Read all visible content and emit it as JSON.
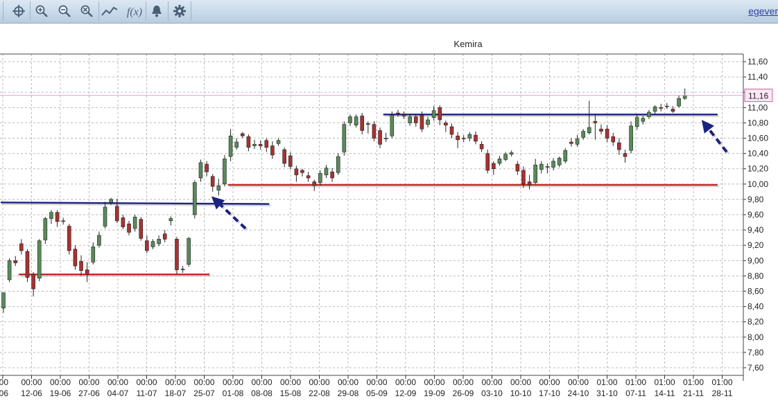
{
  "toolbar": {
    "buttons": [
      {
        "name": "crosshair-icon"
      },
      {
        "name": "zoom-in-icon"
      },
      {
        "name": "zoom-out-icon"
      },
      {
        "name": "zoom-reset-icon"
      },
      {
        "name": "line-tool-icon"
      },
      {
        "name": "function-icon"
      },
      {
        "name": "alert-bell-icon"
      },
      {
        "name": "settings-gear-icon"
      }
    ],
    "function_label": "f(x)",
    "link_text": "egever"
  },
  "chart_data": {
    "type": "candlestick",
    "title": "Kemira",
    "ylim": [
      7.5,
      11.7
    ],
    "yticks": [
      "7,60",
      "7,80",
      "8,00",
      "8,20",
      "8,40",
      "8,60",
      "8,80",
      "9,00",
      "9,20",
      "9,40",
      "9,60",
      "9,80",
      "10,00",
      "10,20",
      "10,40",
      "10,60",
      "10,80",
      "11,00",
      "11,20",
      "11,40",
      "11,60"
    ],
    "last_price_label": "11,16",
    "last_price": 11.16,
    "x_ticks": [
      {
        "top": "00",
        "bottom": "06"
      },
      {
        "top": "00:00",
        "bottom": "12-06"
      },
      {
        "top": "00:00",
        "bottom": "19-06"
      },
      {
        "top": "00:00",
        "bottom": "27-06"
      },
      {
        "top": "00:00",
        "bottom": "04-07"
      },
      {
        "top": "00:00",
        "bottom": "11-07"
      },
      {
        "top": "00:00",
        "bottom": "18-07"
      },
      {
        "top": "00:00",
        "bottom": "25-07"
      },
      {
        "top": "00:00",
        "bottom": "01-08"
      },
      {
        "top": "00:00",
        "bottom": "08-08"
      },
      {
        "top": "00:00",
        "bottom": "15-08"
      },
      {
        "top": "00:00",
        "bottom": "22-08"
      },
      {
        "top": "00:00",
        "bottom": "29-08"
      },
      {
        "top": "00:00",
        "bottom": "05-09"
      },
      {
        "top": "00:00",
        "bottom": "12-09"
      },
      {
        "top": "00:00",
        "bottom": "19-09"
      },
      {
        "top": "00:00",
        "bottom": "26-09"
      },
      {
        "top": "00:00",
        "bottom": "03-10"
      },
      {
        "top": "00:00",
        "bottom": "10-10"
      },
      {
        "top": "00:00",
        "bottom": "17-10"
      },
      {
        "top": "00:00",
        "bottom": "24-10"
      },
      {
        "top": "01:00",
        "bottom": "31-10"
      },
      {
        "top": "01:00",
        "bottom": "07-11"
      },
      {
        "top": "01:00",
        "bottom": "14-11"
      },
      {
        "top": "01:00",
        "bottom": "21-11"
      },
      {
        "top": "01:00",
        "bottom": "28-11"
      }
    ],
    "candles": [
      [
        8.38,
        8.58,
        8.58,
        8.32
      ],
      [
        8.75,
        9.0,
        9.03,
        8.72
      ],
      [
        9.0,
        8.97,
        9.06,
        8.93
      ],
      [
        9.22,
        9.13,
        9.28,
        9.08
      ],
      [
        9.12,
        8.78,
        9.15,
        8.72
      ],
      [
        8.82,
        8.63,
        8.85,
        8.53
      ],
      [
        8.77,
        9.26,
        9.28,
        8.73
      ],
      [
        9.27,
        9.55,
        9.57,
        9.22
      ],
      [
        9.55,
        9.63,
        9.66,
        9.48
      ],
      [
        9.63,
        9.51,
        9.66,
        9.44
      ],
      [
        9.52,
        9.52,
        9.56,
        9.47
      ],
      [
        9.45,
        9.13,
        9.48,
        9.08
      ],
      [
        9.15,
        8.93,
        9.2,
        8.88
      ],
      [
        8.99,
        8.87,
        9.07,
        8.8
      ],
      [
        8.88,
        8.82,
        8.98,
        8.72
      ],
      [
        8.98,
        9.18,
        9.24,
        8.95
      ],
      [
        9.2,
        9.33,
        9.38,
        9.17
      ],
      [
        9.45,
        9.7,
        9.77,
        9.42
      ],
      [
        9.76,
        9.8,
        9.82,
        9.73
      ],
      [
        9.71,
        9.52,
        9.81,
        9.49
      ],
      [
        9.56,
        9.44,
        9.6,
        9.41
      ],
      [
        9.48,
        9.37,
        9.52,
        9.33
      ],
      [
        9.42,
        9.57,
        9.6,
        9.38
      ],
      [
        9.54,
        9.29,
        9.57,
        9.26
      ],
      [
        9.26,
        9.13,
        9.33,
        9.1
      ],
      [
        9.18,
        9.25,
        9.28,
        9.15
      ],
      [
        9.22,
        9.28,
        9.33,
        9.19
      ],
      [
        9.35,
        9.28,
        9.4,
        9.24
      ],
      [
        9.52,
        9.55,
        9.58,
        9.46
      ],
      [
        9.28,
        8.88,
        9.31,
        8.82
      ],
      [
        8.88,
        8.89,
        8.93,
        8.84
      ],
      [
        8.95,
        9.29,
        9.31,
        8.92
      ],
      [
        9.6,
        10.02,
        10.05,
        9.55
      ],
      [
        10.08,
        10.28,
        10.32,
        10.03
      ],
      [
        10.26,
        10.16,
        10.3,
        10.1
      ],
      [
        10.1,
        9.97,
        10.13,
        9.9
      ],
      [
        9.92,
        9.98,
        10.07,
        9.85
      ],
      [
        10.0,
        10.33,
        10.38,
        9.97
      ],
      [
        10.36,
        10.63,
        10.72,
        10.3
      ],
      [
        10.48,
        10.55,
        10.6,
        10.45
      ],
      [
        10.66,
        10.63,
        10.68,
        10.6
      ],
      [
        10.62,
        10.48,
        10.65,
        10.43
      ],
      [
        10.5,
        10.52,
        10.58,
        10.46
      ],
      [
        10.52,
        10.5,
        10.57,
        10.45
      ],
      [
        10.57,
        10.48,
        10.6,
        10.42
      ],
      [
        10.5,
        10.38,
        10.56,
        10.33
      ],
      [
        10.53,
        10.57,
        10.6,
        10.5
      ],
      [
        10.45,
        10.27,
        10.48,
        10.22
      ],
      [
        10.37,
        10.23,
        10.42,
        10.19
      ],
      [
        10.2,
        10.12,
        10.24,
        10.03
      ],
      [
        10.18,
        10.15,
        10.2,
        10.1
      ],
      [
        10.11,
        10.08,
        10.16,
        10.03
      ],
      [
        10.03,
        9.98,
        10.06,
        9.91
      ],
      [
        10.02,
        10.14,
        10.18,
        9.98
      ],
      [
        10.12,
        10.21,
        10.25,
        10.08
      ],
      [
        10.16,
        10.08,
        10.21,
        10.03
      ],
      [
        10.15,
        10.36,
        10.4,
        10.12
      ],
      [
        10.42,
        10.78,
        10.82,
        10.37
      ],
      [
        10.8,
        10.88,
        10.91,
        10.76
      ],
      [
        10.77,
        10.88,
        10.91,
        10.74
      ],
      [
        10.89,
        10.7,
        10.93,
        10.65
      ],
      [
        10.79,
        10.78,
        10.82,
        10.66
      ],
      [
        10.78,
        10.6,
        10.82,
        10.56
      ],
      [
        10.7,
        10.52,
        10.74,
        10.47
      ],
      [
        10.6,
        10.6,
        10.67,
        10.55
      ],
      [
        10.63,
        10.9,
        10.95,
        10.6
      ],
      [
        10.93,
        10.92,
        10.97,
        10.88
      ],
      [
        10.91,
        10.89,
        10.95,
        10.85
      ],
      [
        10.8,
        10.88,
        10.92,
        10.76
      ],
      [
        10.88,
        10.8,
        10.92,
        10.75
      ],
      [
        10.9,
        10.72,
        10.95,
        10.68
      ],
      [
        10.78,
        10.84,
        10.88,
        10.74
      ],
      [
        10.87,
        10.96,
        11.02,
        10.83
      ],
      [
        11.0,
        10.84,
        11.03,
        10.77
      ],
      [
        10.8,
        10.77,
        10.83,
        10.68
      ],
      [
        10.75,
        10.65,
        10.79,
        10.6
      ],
      [
        10.63,
        10.58,
        10.68,
        10.47
      ],
      [
        10.6,
        10.6,
        10.64,
        10.55
      ],
      [
        10.6,
        10.65,
        10.68,
        10.56
      ],
      [
        10.64,
        10.56,
        10.69,
        10.52
      ],
      [
        10.52,
        10.46,
        10.56,
        10.42
      ],
      [
        10.4,
        10.18,
        10.45,
        10.14
      ],
      [
        10.27,
        10.2,
        10.3,
        10.12
      ],
      [
        10.27,
        10.33,
        10.37,
        10.24
      ],
      [
        10.32,
        10.39,
        10.42,
        10.3
      ],
      [
        10.39,
        10.41,
        10.44,
        10.36
      ],
      [
        10.26,
        10.17,
        10.3,
        10.12
      ],
      [
        10.18,
        10.0,
        10.23,
        9.95
      ],
      [
        10.03,
        9.99,
        10.12,
        9.93
      ],
      [
        10.02,
        10.25,
        10.33,
        10.0
      ],
      [
        10.19,
        10.26,
        10.3,
        10.14
      ],
      [
        10.22,
        10.23,
        10.27,
        10.14
      ],
      [
        10.22,
        10.3,
        10.34,
        10.18
      ],
      [
        10.25,
        10.34,
        10.36,
        10.22
      ],
      [
        10.3,
        10.44,
        10.47,
        10.27
      ],
      [
        10.55,
        10.53,
        10.6,
        10.49
      ],
      [
        10.52,
        10.59,
        10.64,
        10.49
      ],
      [
        10.61,
        10.69,
        10.72,
        10.58
      ],
      [
        10.67,
        10.74,
        11.09,
        10.65
      ],
      [
        10.82,
        10.8,
        10.92,
        10.58
      ],
      [
        10.72,
        10.69,
        10.78,
        10.65
      ],
      [
        10.72,
        10.6,
        10.77,
        10.55
      ],
      [
        10.62,
        10.55,
        10.67,
        10.5
      ],
      [
        10.54,
        10.45,
        10.6,
        10.38
      ],
      [
        10.4,
        10.36,
        10.45,
        10.28
      ],
      [
        10.44,
        10.76,
        10.82,
        10.4
      ],
      [
        10.75,
        10.87,
        10.9,
        10.71
      ],
      [
        10.82,
        10.86,
        10.89,
        10.78
      ],
      [
        10.88,
        10.94,
        10.97,
        10.85
      ],
      [
        10.95,
        11.01,
        11.03,
        10.92
      ],
      [
        11.0,
        10.99,
        11.05,
        10.95
      ],
      [
        11.02,
        11.02,
        11.06,
        10.98
      ],
      [
        10.98,
        10.95,
        11.02,
        10.93
      ],
      [
        11.02,
        11.12,
        11.16,
        11.0
      ],
      [
        11.12,
        11.16,
        11.25,
        11.1
      ]
    ],
    "candle_x_start": 5,
    "candle_spacing": 8.65,
    "candle_x_positions_hint": "evenly spaced trading days",
    "lines": [
      {
        "color": "#1a237e",
        "y1": 9.76,
        "y2": 9.74,
        "x_from": 0,
        "x_to": 44
      },
      {
        "color": "#c62828",
        "y1": 8.82,
        "y2": 8.82,
        "x_from": 3,
        "x_to": 34
      },
      {
        "color": "#c62828",
        "y1": 9.99,
        "y2": 9.99,
        "x_from": 38,
        "x_to": 119
      },
      {
        "color": "#1a237e",
        "y1": 10.91,
        "y2": 10.91,
        "x_from": 64,
        "x_to": 119
      }
    ],
    "arrows": [
      {
        "color": "#1a237e",
        "from_index": 40.5,
        "from_value": 9.42,
        "to_index": 34.8,
        "to_value": 9.84
      },
      {
        "color": "#1a237e",
        "from_index": 121,
        "from_value": 10.42,
        "to_index": 116.8,
        "to_value": 10.84
      }
    ],
    "grid": true,
    "colors": {
      "up": "#5a8a5a",
      "down": "#a83232",
      "wick": "#222222",
      "grid": "#b9b9b9",
      "last_price_line": "#e8a0c8",
      "last_price_box": "#c060a0"
    }
  }
}
